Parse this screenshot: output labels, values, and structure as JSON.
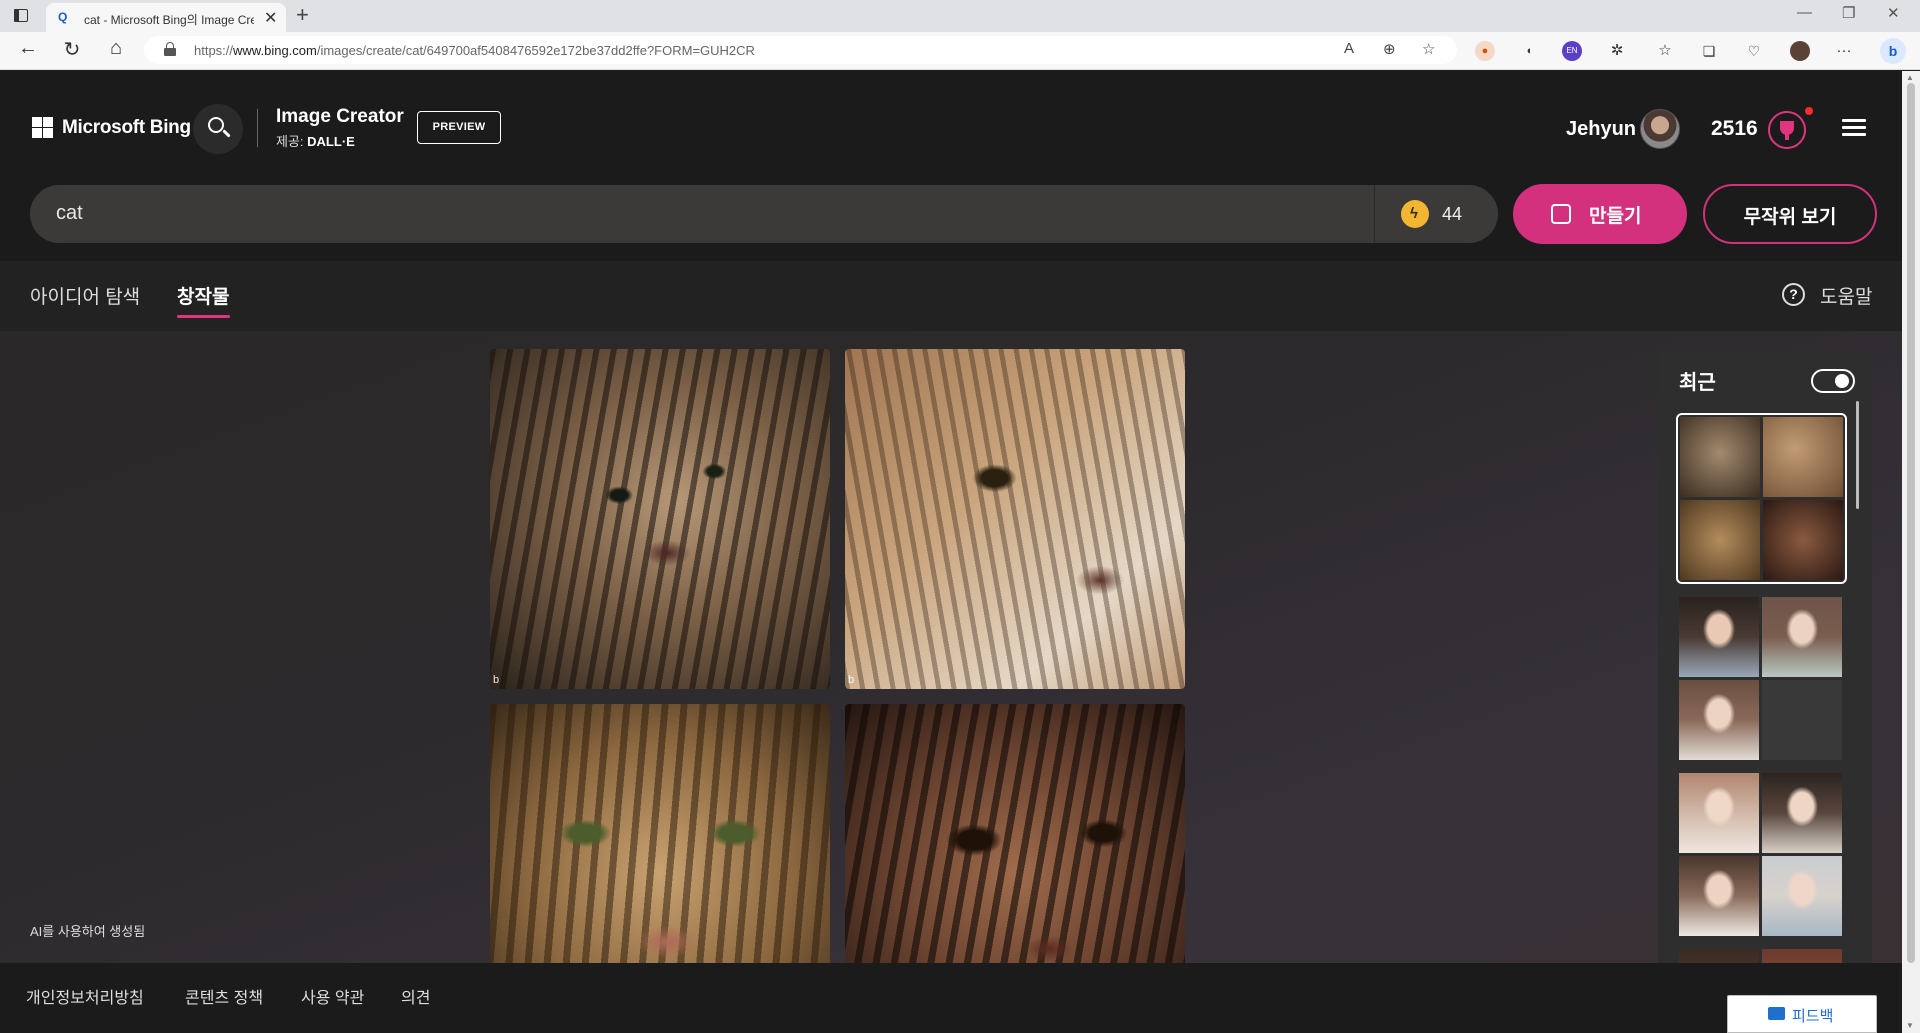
{
  "browser": {
    "tab_title": "cat - Microsoft Bing의 Image Creator",
    "url_prefix": "https://",
    "url_domain": "www.bing.com",
    "url_path": "/images/create/cat/649700af5408476592e172be37dd2ffe?FORM=GUH2CR"
  },
  "header": {
    "brand": "Microsoft Bing",
    "app_title": "Image Creator",
    "provider_prefix": "제공: ",
    "provider_name": "DALL·E",
    "preview_badge": "PREVIEW",
    "user_name": "Jehyun",
    "points": "2516"
  },
  "prompt": {
    "value": "cat",
    "boosts": "44",
    "create_label": "만들기",
    "surprise_label": "무작위 보기"
  },
  "tabs": {
    "explore": "아이디어 탐색",
    "creations": "창작물",
    "help": "도움말"
  },
  "results": {
    "badge": "b",
    "ai_note": "AI를 사용하여 생성됨"
  },
  "recent": {
    "title": "최근",
    "toggle_on": true
  },
  "footer": {
    "privacy": "개인정보처리방침",
    "content_policy": "콘텐츠 정책",
    "terms": "사용 약관",
    "feedback_link": "의견",
    "feedback_button": "피드백"
  },
  "colors": {
    "accent": "#d3317d",
    "boost": "#f2b632",
    "page_bg": "#262424"
  }
}
